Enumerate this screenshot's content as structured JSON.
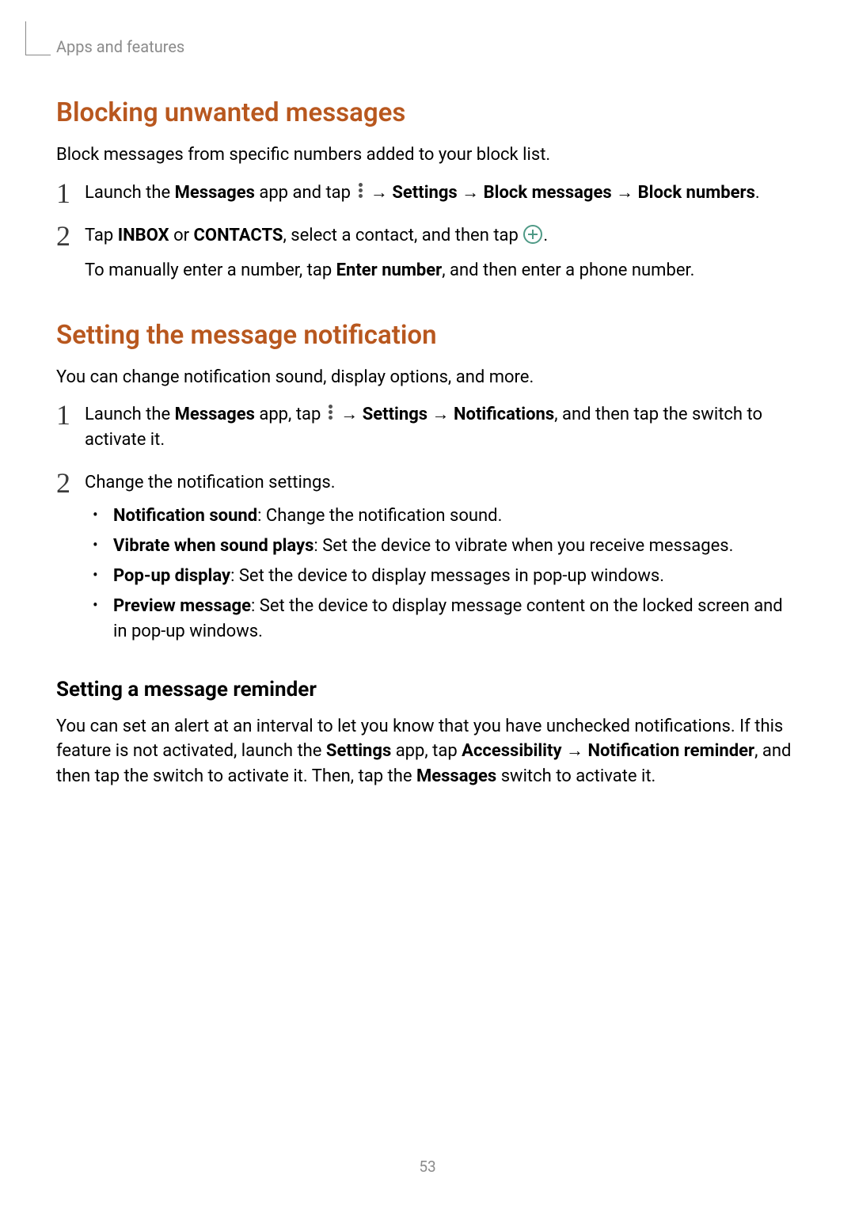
{
  "breadcrumb": "Apps and features",
  "page_number": "53",
  "section1": {
    "heading": "Blocking unwanted messages",
    "intro": "Block messages from specific numbers added to your block list.",
    "step1": {
      "num": "1",
      "part1a": "Launch the ",
      "part1b": "Messages",
      "part1c": " app and tap ",
      "arrow1": " → ",
      "part1d": "Settings",
      "arrow2": " → ",
      "part1e": "Block messages",
      "arrow3": " → ",
      "part1f": "Block numbers",
      "part1g": "."
    },
    "step2": {
      "num": "2",
      "part2a": "Tap ",
      "part2b": "INBOX",
      "part2c": " or ",
      "part2d": "CONTACTS",
      "part2e": ", select a contact, and then tap ",
      "part2f": ".",
      "sub_a": "To manually enter a number, tap ",
      "sub_b": "Enter number",
      "sub_c": ", and then enter a phone number."
    }
  },
  "section2": {
    "heading": "Setting the message notification",
    "intro": "You can change notification sound, display options, and more.",
    "step1": {
      "num": "1",
      "a": "Launch the ",
      "b": "Messages",
      "c": " app, tap ",
      "arrow1": " → ",
      "d": "Settings",
      "arrow2": " → ",
      "e": "Notifications",
      "f": ", and then tap the switch to activate it."
    },
    "step2": {
      "num": "2",
      "text": "Change the notification settings.",
      "bullets": [
        {
          "label": "Notification sound",
          "desc": ": Change the notification sound."
        },
        {
          "label": "Vibrate when sound plays",
          "desc": ": Set the device to vibrate when you receive messages."
        },
        {
          "label": "Pop-up display",
          "desc": ": Set the device to display messages in pop-up windows."
        },
        {
          "label": "Preview message",
          "desc": ": Set the device to display message content on the locked screen and in pop-up windows."
        }
      ]
    },
    "sub": {
      "heading": "Setting a message reminder",
      "para_a": "You can set an alert at an interval to let you know that you have unchecked notifications. If this feature is not activated, launch the ",
      "para_b": "Settings",
      "para_c": " app, tap ",
      "para_d": "Accessibility",
      "arrow1": " → ",
      "para_e": "Notification reminder",
      "para_f": ", and then tap the switch to activate it. Then, tap the ",
      "para_g": "Messages",
      "para_h": " switch to activate it."
    }
  }
}
